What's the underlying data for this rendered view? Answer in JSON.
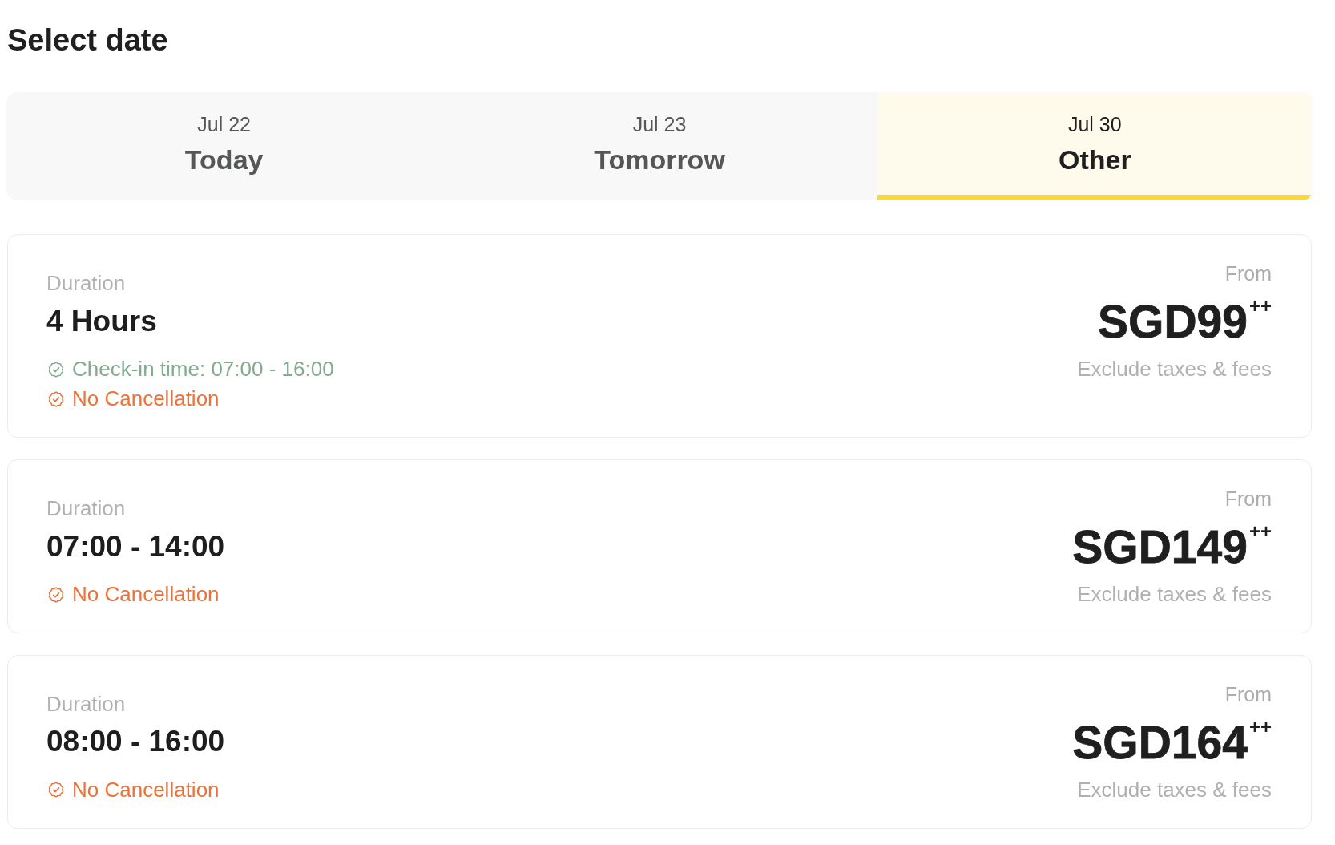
{
  "title": "Select date",
  "date_tabs": [
    {
      "date": "Jul 22",
      "label": "Today",
      "selected": false
    },
    {
      "date": "Jul 23",
      "label": "Tomorrow",
      "selected": false
    },
    {
      "date": "Jul 30",
      "label": "Other",
      "selected": true
    }
  ],
  "options": [
    {
      "duration_label": "Duration",
      "duration": "4 Hours",
      "features": [
        {
          "text": "Check-in time: 07:00 - 16:00",
          "color": "#84ab8f"
        },
        {
          "text": "No Cancellation",
          "color": "#e9733a"
        }
      ],
      "price_prefix": "From",
      "price": "SGD99$^{++}$",
      "price_note": "Exclude taxes & fees"
    },
    {
      "duration_label": "Duration",
      "duration": "07:00 - 14:00",
      "features": [
        {
          "text": "No Cancellation",
          "color": "#e9733a"
        }
      ],
      "price_prefix": "From",
      "price": "SGD149$^{++}$",
      "price_note": "Exclude taxes & fees"
    },
    {
      "duration_label": "Duration",
      "duration": "08:00 - 16:00",
      "features": [
        {
          "text": "No Cancellation",
          "color": "#e9733a"
        }
      ],
      "price_prefix": "From",
      "price": "SGD164$^{++}$",
      "price_note": "Exclude taxes & fees"
    }
  ]
}
